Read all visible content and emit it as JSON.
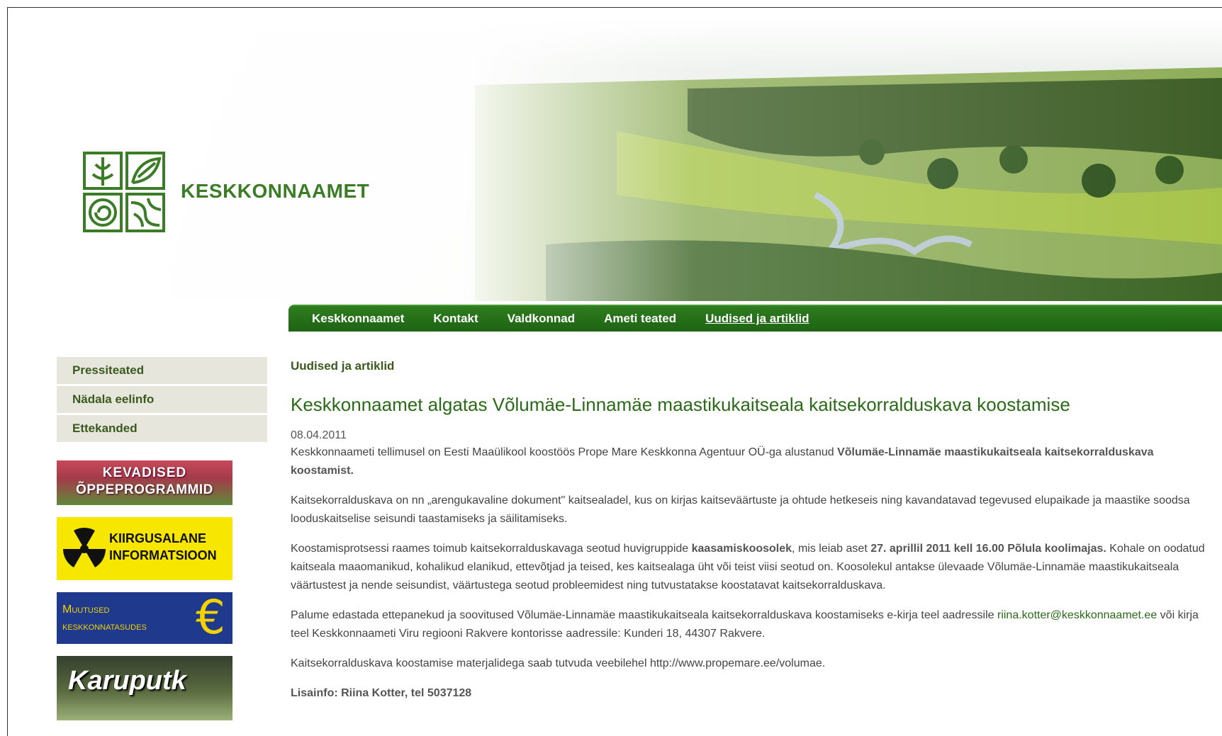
{
  "header": {
    "logo_text": "KESKKONNAAMET"
  },
  "nav": {
    "items": [
      "Keskkonnaamet",
      "Kontakt",
      "Valdkonnad",
      "Ameti teated",
      "Uudised ja artiklid"
    ],
    "active_index": 4
  },
  "sidebar": {
    "items": [
      "Pressiteated",
      "Nädala eelinfo",
      "Ettekanded"
    ],
    "ads": [
      {
        "line1": "KEVADISED",
        "line2": "ÕPPEPROGRAMMID"
      },
      {
        "line1": "KIIRGUSALANE",
        "line2": "INFORMATSIOON"
      },
      {
        "line1": "Muutused",
        "line2": "keskkonnatasudes"
      },
      {
        "line1": "Karuputk"
      }
    ]
  },
  "article": {
    "breadcrumb": "Uudised ja artiklid",
    "title": "Keskkonnaamet algatas Võlumäe-Linnamäe maastikukaitseala kaitsekorralduskava koostamise",
    "date": "08.04.2011",
    "p1_a": "Keskkonnaameti tellimusel on Eesti Maaülikool koostöös Prope Mare Keskkonna Agentuur OÜ-ga alustanud ",
    "p1_b": "Võlumäe-Linnamäe maastikukaitseala kaitsekorralduskava koostamist.",
    "p2": "Kaitsekorralduskava on nn „arengukavaline dokument\" kaitsealadel, kus on kirjas kaitseväärtuste ja ohtude hetkeseis ning kavandatavad tegevused elupaikade ja maastike soodsa looduskaitselise seisundi taastamiseks ja säilitamiseks.",
    "p3_a": "Koostamisprotsessi raames toimub kaitsekorralduskavaga seotud huvigruppide ",
    "p3_b": "kaasamiskoosolek",
    "p3_c": ", mis leiab aset ",
    "p3_d": "27. aprillil 2011 kell 16.00 Põlula koolimajas.",
    "p3_e": " Kohale on oodatud kaitseala maaomanikud, kohalikud elanikud, ettevõtjad ja teised, kes kaitsealaga üht või teist viisi seotud on. Koosolekul antakse ülevaade Võlumäe-Linnamäe maastikukaitseala väärtustest ja nende seisundist, väärtustega seotud probleemidest ning tutvustatakse koostatavat kaitsekorralduskava.",
    "p4_a": "Palume edastada ettepanekud ja soovitused Võlumäe-Linnamäe maastikukaitseala kaitsekorralduskava koostamiseks e-kirja teel aadressile ",
    "p4_email": "riina.kotter@keskkonnaamet.ee",
    "p4_b": " või kirja teel Keskkonnaameti Viru regiooni Rakvere kontorisse aadressile: Kunderi 18, 44307 Rakvere.",
    "p5_a": "Kaitsekorralduskava koostamise materjalidega saab tutvuda veebilehel ",
    "p5_link": "http://www.propemare.ee/volumae",
    "p5_b": ".",
    "p6": "Lisainfo: Riina Kotter, tel 5037128"
  },
  "colors": {
    "brand_green": "#2e7d1f",
    "sidebar_bg": "#e6e6dc"
  }
}
